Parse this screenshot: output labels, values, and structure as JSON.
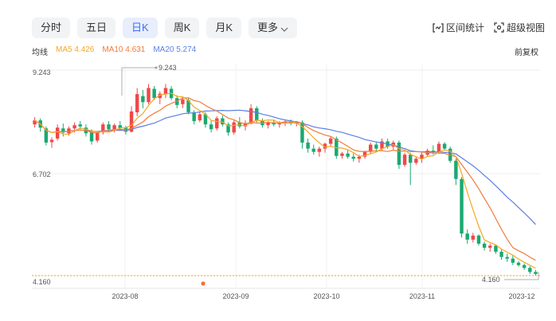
{
  "tabs": [
    {
      "label": "分时",
      "active": false
    },
    {
      "label": "五日",
      "active": false
    },
    {
      "label": "日K",
      "active": true
    },
    {
      "label": "周K",
      "active": false
    },
    {
      "label": "月K",
      "active": false
    },
    {
      "label": "更多",
      "active": false
    }
  ],
  "tools": {
    "interval_stats": "区间统计",
    "super_view": "超级视图"
  },
  "legend": {
    "ma_label": "均线",
    "ma5": "MA5 4.426",
    "ma10": "MA10 4.631",
    "ma20": "MA20 5.274"
  },
  "adjust_label": "前复权",
  "colors": {
    "up": "#f04848",
    "down": "#1aa971",
    "ma5": "#f5a623",
    "ma10": "#f07b3a",
    "ma20": "#5b7ee5",
    "accent": "#3b6ff5"
  },
  "chart_data": {
    "type": "candlestick",
    "y_ticks": [
      "9.243",
      "6.702",
      "4.160"
    ],
    "ylim": [
      4.16,
      9.243
    ],
    "x_ticks": [
      "2023-08",
      "2023-09",
      "2023-10",
      "2023-11",
      "2023-12"
    ],
    "max_label": "9.243",
    "last_price_label": "4.160",
    "ohlc": [
      [
        7.9,
        8.08,
        7.82,
        8.0
      ],
      [
        8.0,
        8.05,
        7.72,
        7.82
      ],
      [
        7.8,
        7.85,
        7.38,
        7.45
      ],
      [
        7.46,
        7.58,
        7.32,
        7.52
      ],
      [
        7.55,
        7.9,
        7.5,
        7.82
      ],
      [
        7.8,
        7.92,
        7.6,
        7.7
      ],
      [
        7.68,
        7.85,
        7.62,
        7.8
      ],
      [
        7.8,
        7.95,
        7.7,
        7.88
      ],
      [
        7.9,
        7.98,
        7.78,
        7.85
      ],
      [
        7.82,
        7.9,
        7.6,
        7.68
      ],
      [
        7.7,
        7.78,
        7.4,
        7.48
      ],
      [
        7.5,
        7.72,
        7.45,
        7.7
      ],
      [
        7.7,
        7.95,
        7.65,
        7.9
      ],
      [
        7.9,
        7.98,
        7.72,
        7.78
      ],
      [
        7.78,
        7.92,
        7.7,
        7.88
      ],
      [
        7.88,
        7.98,
        7.75,
        7.8
      ],
      [
        7.82,
        7.86,
        7.65,
        7.72
      ],
      [
        7.72,
        8.35,
        7.7,
        8.22
      ],
      [
        8.2,
        8.8,
        8.1,
        8.65
      ],
      [
        8.6,
        8.75,
        8.3,
        8.45
      ],
      [
        8.45,
        8.9,
        8.4,
        8.8
      ],
      [
        8.78,
        8.85,
        8.5,
        8.55
      ],
      [
        8.55,
        8.72,
        8.4,
        8.66
      ],
      [
        8.65,
        8.9,
        8.55,
        8.8
      ],
      [
        8.78,
        8.85,
        8.5,
        8.55
      ],
      [
        8.55,
        8.62,
        8.3,
        8.38
      ],
      [
        8.4,
        8.58,
        8.3,
        8.52
      ],
      [
        8.5,
        8.55,
        8.15,
        8.2
      ],
      [
        8.2,
        8.25,
        7.9,
        7.98
      ],
      [
        8.0,
        8.22,
        7.95,
        8.15
      ],
      [
        8.15,
        8.2,
        7.82,
        7.9
      ],
      [
        7.9,
        8.0,
        7.7,
        7.78
      ],
      [
        7.8,
        8.1,
        7.75,
        8.05
      ],
      [
        8.05,
        8.12,
        7.85,
        7.9
      ],
      [
        7.9,
        7.95,
        7.62,
        7.7
      ],
      [
        7.7,
        8.0,
        7.65,
        7.95
      ],
      [
        7.95,
        8.08,
        7.8,
        7.85
      ],
      [
        7.85,
        8.0,
        7.75,
        7.92
      ],
      [
        7.92,
        8.4,
        7.9,
        8.3
      ],
      [
        8.3,
        8.35,
        7.95,
        8.0
      ],
      [
        8.0,
        8.05,
        7.82,
        7.88
      ],
      [
        7.88,
        7.98,
        7.8,
        7.95
      ],
      [
        7.95,
        8.02,
        7.85,
        7.9
      ],
      [
        7.9,
        7.98,
        7.82,
        7.94
      ],
      [
        7.94,
        8.0,
        7.86,
        7.96
      ],
      [
        7.96,
        8.02,
        7.88,
        7.92
      ],
      [
        7.92,
        7.98,
        7.85,
        7.95
      ],
      [
        7.95,
        8.0,
        7.3,
        7.45
      ],
      [
        7.45,
        7.55,
        7.2,
        7.3
      ],
      [
        7.3,
        7.4,
        7.15,
        7.22
      ],
      [
        7.22,
        7.35,
        7.1,
        7.3
      ],
      [
        7.3,
        7.45,
        7.2,
        7.42
      ],
      [
        7.42,
        7.6,
        7.35,
        7.55
      ],
      [
        7.55,
        7.6,
        7.05,
        7.12
      ],
      [
        7.12,
        7.22,
        7.05,
        7.18
      ],
      [
        7.18,
        7.26,
        7.05,
        7.1
      ],
      [
        7.1,
        7.18,
        6.98,
        7.05
      ],
      [
        7.05,
        7.15,
        6.95,
        7.1
      ],
      [
        7.1,
        7.25,
        7.05,
        7.22
      ],
      [
        7.22,
        7.45,
        7.18,
        7.4
      ],
      [
        7.4,
        7.46,
        7.22,
        7.3
      ],
      [
        7.3,
        7.55,
        7.26,
        7.48
      ],
      [
        7.48,
        7.55,
        7.3,
        7.35
      ],
      [
        7.35,
        7.5,
        7.28,
        7.45
      ],
      [
        7.45,
        7.5,
        6.8,
        6.9
      ],
      [
        6.9,
        7.2,
        6.85,
        7.15
      ],
      [
        7.15,
        7.2,
        6.4,
        6.95
      ],
      [
        6.95,
        7.1,
        6.9,
        7.05
      ],
      [
        7.05,
        7.2,
        6.95,
        7.15
      ],
      [
        7.15,
        7.3,
        7.1,
        7.25
      ],
      [
        7.25,
        7.38,
        7.15,
        7.22
      ],
      [
        7.22,
        7.48,
        7.18,
        7.42
      ],
      [
        7.42,
        7.46,
        7.25,
        7.3
      ],
      [
        7.3,
        7.35,
        6.95,
        7.0
      ],
      [
        7.0,
        7.05,
        6.4,
        6.55
      ],
      [
        6.55,
        6.6,
        5.1,
        5.2
      ],
      [
        5.2,
        5.3,
        4.95,
        5.05
      ],
      [
        5.05,
        5.22,
        4.98,
        5.15
      ],
      [
        5.15,
        5.18,
        4.9,
        4.95
      ],
      [
        4.95,
        5.0,
        4.78,
        4.85
      ],
      [
        4.85,
        4.95,
        4.75,
        4.9
      ],
      [
        4.9,
        4.92,
        4.7,
        4.75
      ],
      [
        4.75,
        4.8,
        4.55,
        4.62
      ],
      [
        4.62,
        4.7,
        4.5,
        4.58
      ],
      [
        4.58,
        4.65,
        4.42,
        4.48
      ],
      [
        4.48,
        4.52,
        4.38,
        4.42
      ],
      [
        4.42,
        4.46,
        4.3,
        4.35
      ],
      [
        4.35,
        4.4,
        4.2,
        4.25
      ],
      [
        4.25,
        4.3,
        4.16,
        4.2
      ]
    ]
  }
}
